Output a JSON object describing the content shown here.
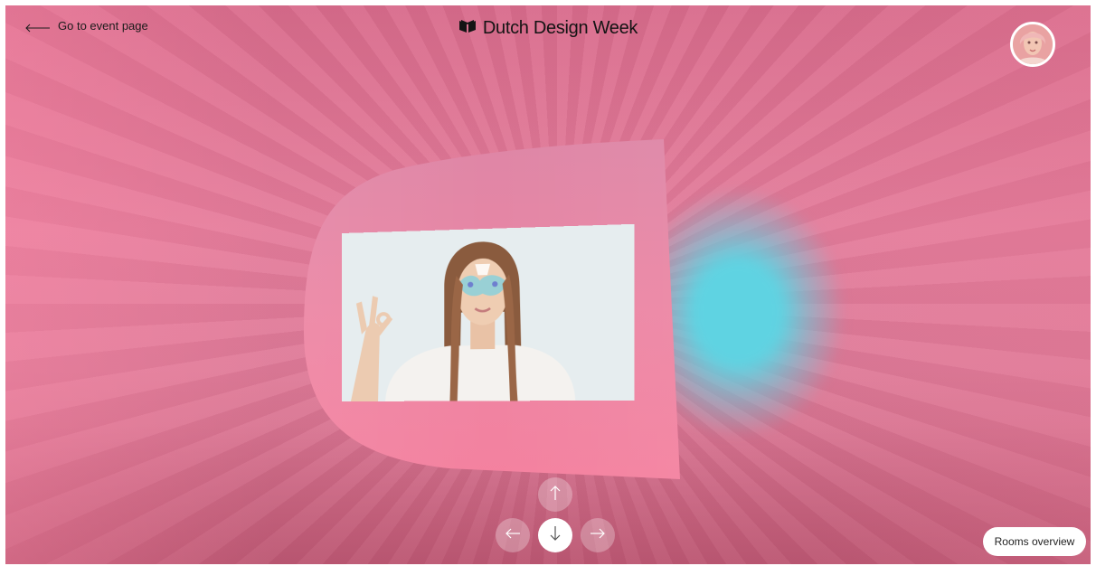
{
  "header": {
    "back_link_label": "Go to event page",
    "brand_name": "Dutch Design Week",
    "brand_icon": "ddw-logo-icon"
  },
  "user": {
    "avatar_icon": "user-avatar"
  },
  "navigation": {
    "up_icon": "arrow-up-icon",
    "down_icon": "arrow-down-icon",
    "left_icon": "arrow-left-icon",
    "right_icon": "arrow-right-icon"
  },
  "footer": {
    "rooms_overview_label": "Rooms overview"
  },
  "colors": {
    "background_pink": "#e57c9b",
    "panel_pink": "#e98aa8",
    "glow_cyan": "#5fd3e2",
    "button_white": "#ffffff"
  }
}
